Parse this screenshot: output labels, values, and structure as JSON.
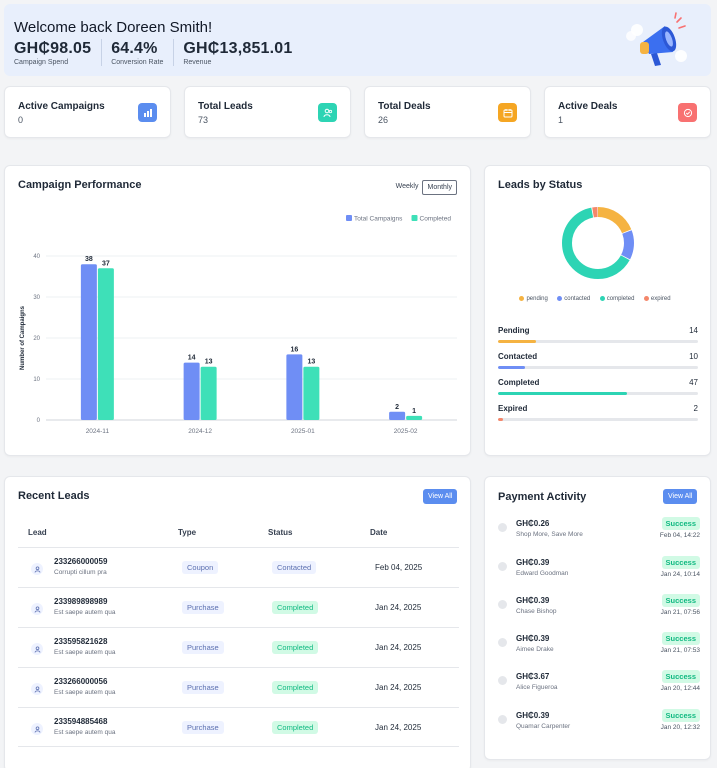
{
  "banner": {
    "welcome": "Welcome back Doreen Smith!",
    "metrics": [
      {
        "value": "GH₵98.05",
        "label": "Campaign Spend"
      },
      {
        "value": "64.4%",
        "label": "Conversion Rate"
      },
      {
        "value": "GH₵13,851.01",
        "label": "Revenue"
      }
    ]
  },
  "stats": [
    {
      "title": "Active Campaigns",
      "value": "0",
      "icon": "bar-chart-icon",
      "color": "#5b8def"
    },
    {
      "title": "Total Leads",
      "value": "73",
      "icon": "users-icon",
      "color": "#2dd4b4"
    },
    {
      "title": "Total Deals",
      "value": "26",
      "icon": "calendar-icon",
      "color": "#f5a623"
    },
    {
      "title": "Active Deals",
      "value": "1",
      "icon": "check-badge-icon",
      "color": "#f87171"
    }
  ],
  "campaign": {
    "title": "Campaign Performance",
    "toggle": [
      "Weekly",
      "Monthly"
    ],
    "active_toggle": "Monthly"
  },
  "chart_data": {
    "type": "bar",
    "categories": [
      "2024-11",
      "2024-12",
      "2025-01",
      "2025-02"
    ],
    "series": [
      {
        "name": "Total Campaigns",
        "values": [
          38,
          14,
          16,
          2
        ],
        "color": "#6f8ef5"
      },
      {
        "name": "Completed",
        "values": [
          37,
          13,
          13,
          1
        ],
        "color": "#3ee0b8"
      }
    ],
    "ylabel": "Number of Campaigns",
    "yticks": [
      0,
      10,
      20,
      30,
      40
    ],
    "ylim": [
      0,
      40
    ],
    "legend": "top-right",
    "grid": true
  },
  "leads_status": {
    "title": "Leads by Status",
    "legend": [
      {
        "label": "pending",
        "color": "#f5b342"
      },
      {
        "label": "contacted",
        "color": "#6f8ef5"
      },
      {
        "label": "completed",
        "color": "#2dd4b4"
      },
      {
        "label": "expired",
        "color": "#f4876b"
      }
    ],
    "items": [
      {
        "label": "Pending",
        "value": 14,
        "color": "#f5b342"
      },
      {
        "label": "Contacted",
        "value": 10,
        "color": "#6f8ef5"
      },
      {
        "label": "Completed",
        "value": 47,
        "color": "#2dd4b4"
      },
      {
        "label": "Expired",
        "value": 2,
        "color": "#f4876b"
      }
    ]
  },
  "recent_leads": {
    "title": "Recent Leads",
    "view_all": "View All",
    "columns": [
      "Lead",
      "Type",
      "Status",
      "Date"
    ],
    "rows": [
      {
        "phone": "233266000059",
        "note": "Corrupti cillum pra",
        "type": "Coupon",
        "status": "Contacted",
        "date": "Feb 04, 2025"
      },
      {
        "phone": "233989898989",
        "note": "Est saepe autem qua",
        "type": "Purchase",
        "status": "Completed",
        "date": "Jan 24, 2025"
      },
      {
        "phone": "233595821628",
        "note": "Est saepe autem qua",
        "type": "Purchase",
        "status": "Completed",
        "date": "Jan 24, 2025"
      },
      {
        "phone": "233266000056",
        "note": "Est saepe autem qua",
        "type": "Purchase",
        "status": "Completed",
        "date": "Jan 24, 2025"
      },
      {
        "phone": "233594885468",
        "note": "Est saepe autem qua",
        "type": "Purchase",
        "status": "Completed",
        "date": "Jan 24, 2025"
      }
    ]
  },
  "payments": {
    "title": "Payment Activity",
    "view_all": "View All",
    "items": [
      {
        "amount": "GH₵0.26",
        "who": "Shop More, Save More",
        "status": "Success",
        "time": "Feb 04, 14:22"
      },
      {
        "amount": "GH₵0.39",
        "who": "Edward Goodman",
        "status": "Success",
        "time": "Jan 24, 10:14"
      },
      {
        "amount": "GH₵0.39",
        "who": "Chase Bishop",
        "status": "Success",
        "time": "Jan 21, 07:56"
      },
      {
        "amount": "GH₵0.39",
        "who": "Aimee Drake",
        "status": "Success",
        "time": "Jan 21, 07:53"
      },
      {
        "amount": "GH₵3.67",
        "who": "Alice Figueroa",
        "status": "Success",
        "time": "Jan 20, 12:44"
      },
      {
        "amount": "GH₵0.39",
        "who": "Quamar Carpenter",
        "status": "Success",
        "time": "Jan 20, 12:32"
      }
    ]
  }
}
